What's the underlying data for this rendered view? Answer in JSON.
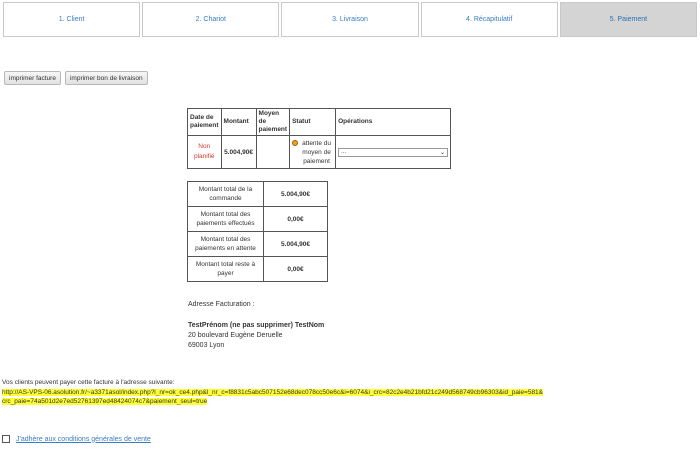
{
  "steps": [
    {
      "label": "1. Client"
    },
    {
      "label": "2. Chariot"
    },
    {
      "label": "3. Livraison"
    },
    {
      "label": "4. Récapitulatif"
    },
    {
      "label": "5. Paiement"
    }
  ],
  "active_step": 5,
  "buttons": {
    "print_invoice": "imprimer facture",
    "print_delivery": "imprimer bon de livraison"
  },
  "payments_table": {
    "headers": [
      "Date de paiement",
      "Montant",
      "Moyen de paiement",
      "Statut",
      "Opérations"
    ],
    "row": {
      "date": "Non planifié",
      "amount": "5.004,90€",
      "method": "",
      "status": "attente du moyen de paiement",
      "operation_selected": "..."
    }
  },
  "totals": [
    {
      "label": "Montant total de la commande",
      "value": "5.004,90€"
    },
    {
      "label": "Montant total des paiements effectués",
      "value": "0,00€"
    },
    {
      "label": "Montant total des paiements en attente",
      "value": "5.004,90€"
    },
    {
      "label": "Montant total reste à payer",
      "value": "0,00€"
    }
  ],
  "billing": {
    "label": "Adresse Facturation :",
    "name": "TestPrénom (ne pas supprimer) TestNom",
    "street": "20 boulevard Eugène Deruelle",
    "city": "69003 Lyon"
  },
  "invoice_link": {
    "intro": "Vos clients peuvent payer cette facture à l'adresse suivante:",
    "url_line1": "http://AS-VPS-06.asolution.fr/~a3371asol/index.php?l_nr=ok_ce4.php&l_nr_c=f8831c5abc507152e68dec078cc50e6c&i=6074&i_crc=82c2e4b21bfd21c249d568749cb96303&id_paie=581&",
    "url_line2": "crc_paie=74a501d2e7ed52761397ed48424074c7&paiement_seul=true"
  },
  "conditions": {
    "label": "J'adhère aux conditions générales de vente",
    "checked": false
  },
  "colors": {
    "link": "#3a7cc0",
    "active_step_bg": "#d4d4d4",
    "non_planned": "#d23a2a",
    "highlight": "#ffff33",
    "status_dot": "#f0a020"
  }
}
